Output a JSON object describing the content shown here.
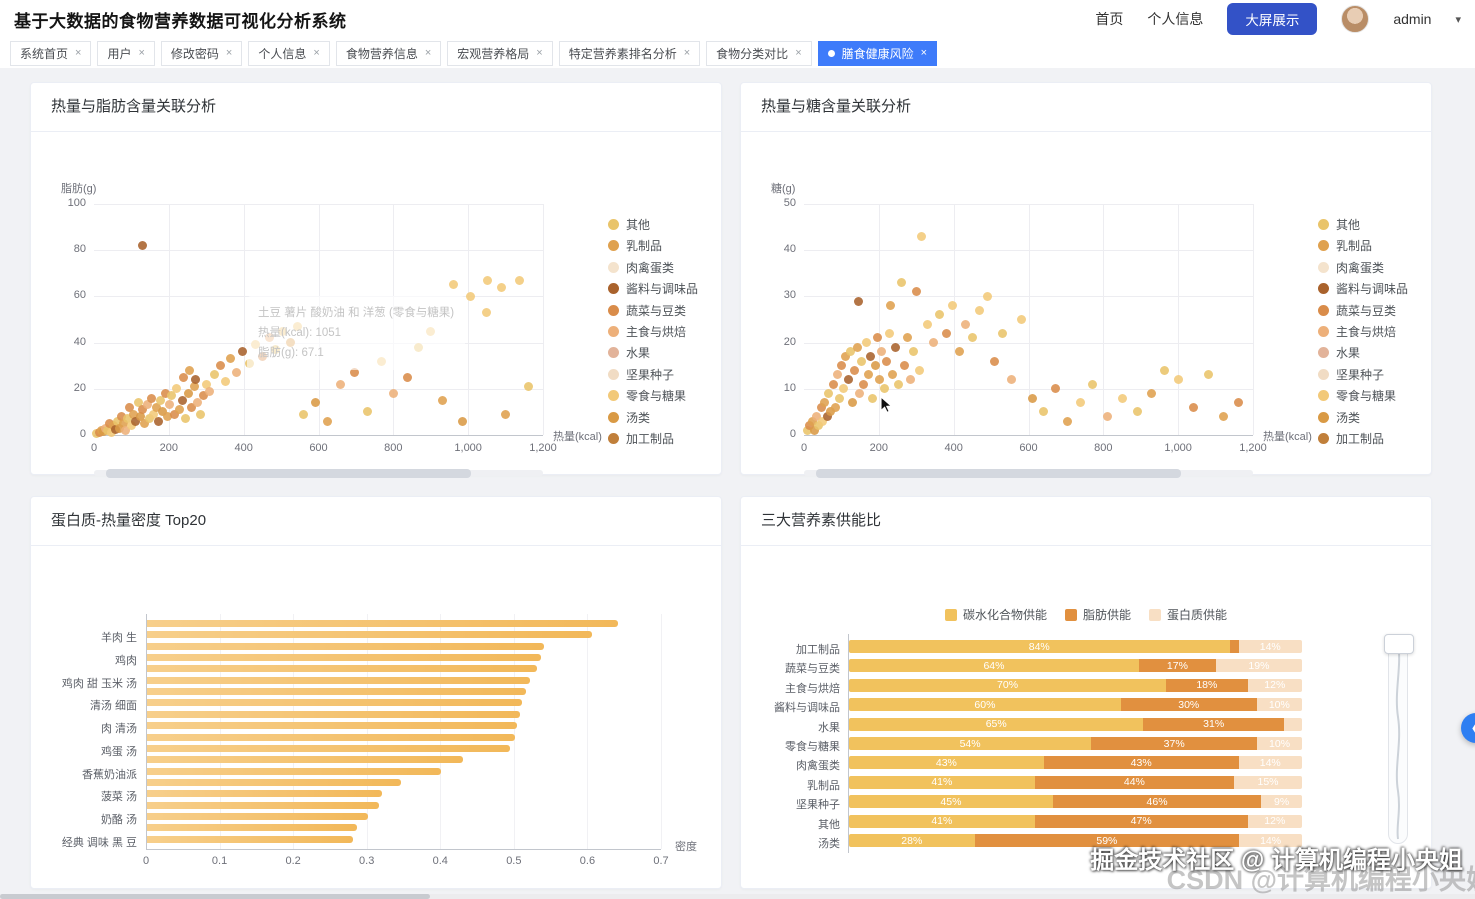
{
  "header": {
    "title": "基于大数据的食物营养数据可视化分析系统",
    "nav_home": "首页",
    "nav_profile": "个人信息",
    "screen_button": "大屏展示",
    "user": "admin"
  },
  "tabs": [
    {
      "label": "系统首页",
      "active": false
    },
    {
      "label": "用户",
      "active": false
    },
    {
      "label": "修改密码",
      "active": false
    },
    {
      "label": "个人信息",
      "active": false
    },
    {
      "label": "食物营养信息",
      "active": false
    },
    {
      "label": "宏观营养格局",
      "active": false
    },
    {
      "label": "特定营养素排名分析",
      "active": false
    },
    {
      "label": "食物分类对比",
      "active": false
    },
    {
      "label": "膳食健康风险",
      "active": true
    }
  ],
  "cards": [
    {
      "title": "热量与脂肪含量关联分析"
    },
    {
      "title": "热量与糖含量关联分析"
    },
    {
      "title": "蛋白质-热量密度 Top20"
    },
    {
      "title": "三大营养素供能比"
    }
  ],
  "watermark": {
    "front": "掘金技术社区 @ 计算机编程小央姐",
    "back": "CSDN @计算机编程小央姐"
  },
  "colors": {
    "active_tab": "#3e7bfa",
    "screen_button": "#3352c7",
    "fab": "#2e7ff2",
    "bar_light": "#f7cf8b",
    "bar": "#f2b859"
  },
  "chart_data": [
    {
      "type": "scatter",
      "title": "热量与脂肪含量关联分析",
      "xlabel": "热量(kcal)",
      "ylabel": "脂肪(g)",
      "xlim": [
        0,
        1200
      ],
      "ylim": [
        0,
        100
      ],
      "xticks": [
        "0",
        "200",
        "400",
        "600",
        "800",
        "1,000",
        "1,200"
      ],
      "yticks": [
        "0",
        "20",
        "40",
        "60",
        "80",
        "100"
      ],
      "legend": [
        "其他",
        "乳制品",
        "肉禽蛋类",
        "酱料与调味品",
        "蔬菜与豆类",
        "主食与烘焙",
        "水果",
        "坚果种子",
        "零食与糖果",
        "汤类",
        "加工制品"
      ],
      "palette": [
        "#e9c46a",
        "#dfa14f",
        "#f4e3cd",
        "#a9622c",
        "#d98c4a",
        "#edb07a",
        "#e2b39a",
        "#f1dcc4",
        "#f2c979",
        "#d99a45",
        "#c07f3a"
      ],
      "tooltip": {
        "lines": [
          "土豆 薯片 酸奶油 和 洋葱 (零食与糖果)",
          "热量(kcal): 1051",
          "脂肪(g): 67.1"
        ]
      },
      "points": [
        [
          8,
          0.5,
          0
        ],
        [
          14,
          1,
          4
        ],
        [
          20,
          2,
          1
        ],
        [
          26,
          1.5,
          9
        ],
        [
          30,
          3,
          5
        ],
        [
          36,
          2,
          0
        ],
        [
          42,
          5,
          4
        ],
        [
          46,
          1,
          8
        ],
        [
          52,
          4,
          1
        ],
        [
          58,
          2.5,
          3
        ],
        [
          62,
          6,
          0
        ],
        [
          68,
          3,
          9
        ],
        [
          74,
          8,
          4
        ],
        [
          78,
          5,
          1
        ],
        [
          84,
          2,
          5
        ],
        [
          90,
          7,
          0
        ],
        [
          96,
          12,
          4
        ],
        [
          100,
          4,
          8
        ],
        [
          106,
          9,
          1
        ],
        [
          112,
          6,
          3
        ],
        [
          118,
          14,
          0
        ],
        [
          124,
          8,
          9
        ],
        [
          130,
          11,
          4
        ],
        [
          136,
          5,
          1
        ],
        [
          142,
          13,
          5
        ],
        [
          148,
          7,
          0
        ],
        [
          154,
          16,
          4
        ],
        [
          160,
          9,
          8
        ],
        [
          166,
          12,
          1
        ],
        [
          172,
          6,
          3
        ],
        [
          178,
          15,
          0
        ],
        [
          184,
          10,
          9
        ],
        [
          190,
          18,
          4
        ],
        [
          196,
          8,
          1
        ],
        [
          202,
          13,
          5
        ],
        [
          208,
          17,
          0
        ],
        [
          214,
          9,
          4
        ],
        [
          220,
          20,
          8
        ],
        [
          228,
          11,
          1
        ],
        [
          236,
          15,
          3
        ],
        [
          244,
          7,
          0
        ],
        [
          252,
          18,
          9
        ],
        [
          260,
          12,
          4
        ],
        [
          268,
          21,
          1
        ],
        [
          276,
          14,
          5
        ],
        [
          284,
          9,
          0
        ],
        [
          292,
          17,
          4
        ],
        [
          300,
          22,
          8
        ],
        [
          240,
          25,
          4
        ],
        [
          255,
          28,
          1
        ],
        [
          270,
          24,
          3
        ],
        [
          310,
          19,
          5
        ],
        [
          322,
          26,
          0
        ],
        [
          338,
          30,
          4
        ],
        [
          352,
          23,
          8
        ],
        [
          366,
          33,
          1
        ],
        [
          380,
          27,
          5
        ],
        [
          398,
          36,
          3
        ],
        [
          415,
          31,
          0
        ],
        [
          432,
          39,
          8
        ],
        [
          450,
          34,
          4
        ],
        [
          468,
          42,
          5
        ],
        [
          486,
          37,
          0
        ],
        [
          505,
          45,
          8
        ],
        [
          524,
          40,
          1
        ],
        [
          545,
          47,
          8
        ],
        [
          130,
          82,
          3
        ],
        [
          560,
          9,
          0
        ],
        [
          592,
          14,
          9
        ],
        [
          625,
          6,
          1
        ],
        [
          660,
          22,
          5
        ],
        [
          695,
          27,
          4
        ],
        [
          730,
          10,
          0
        ],
        [
          768,
          32,
          8
        ],
        [
          800,
          18,
          5
        ],
        [
          838,
          25,
          4
        ],
        [
          868,
          38,
          0
        ],
        [
          900,
          45,
          8
        ],
        [
          932,
          15,
          1
        ],
        [
          960,
          65,
          8
        ],
        [
          1005,
          60,
          8
        ],
        [
          1050,
          53,
          8
        ],
        [
          1090,
          64,
          8
        ],
        [
          1138,
          67,
          8
        ],
        [
          1160,
          21,
          0
        ],
        [
          985,
          6,
          9
        ],
        [
          1100,
          9,
          1
        ],
        [
          1051,
          67,
          8
        ]
      ]
    },
    {
      "type": "scatter",
      "title": "热量与糖含量关联分析",
      "xlabel": "热量(kcal)",
      "ylabel": "糖(g)",
      "xlim": [
        0,
        1200
      ],
      "ylim": [
        0,
        50
      ],
      "xticks": [
        "0",
        "200",
        "400",
        "600",
        "800",
        "1,000",
        "1,200"
      ],
      "yticks": [
        "0",
        "10",
        "20",
        "30",
        "40",
        "50"
      ],
      "legend": [
        "其他",
        "乳制品",
        "肉禽蛋类",
        "酱料与调味品",
        "蔬菜与豆类",
        "主食与烘焙",
        "水果",
        "坚果种子",
        "零食与糖果",
        "汤类",
        "加工制品"
      ],
      "palette": [
        "#e9c46a",
        "#dfa14f",
        "#f4e3cd",
        "#a9622c",
        "#d98c4a",
        "#edb07a",
        "#e2b39a",
        "#f1dcc4",
        "#f2c979",
        "#d99a45",
        "#c07f3a"
      ],
      "points": [
        [
          10,
          1,
          0
        ],
        [
          16,
          2,
          4
        ],
        [
          22,
          3,
          1
        ],
        [
          28,
          1,
          9
        ],
        [
          34,
          4,
          5
        ],
        [
          40,
          2,
          0
        ],
        [
          46,
          6,
          4
        ],
        [
          50,
          3,
          8
        ],
        [
          56,
          7,
          1
        ],
        [
          62,
          4,
          3
        ],
        [
          66,
          9,
          0
        ],
        [
          72,
          5,
          9
        ],
        [
          78,
          11,
          4
        ],
        [
          84,
          6,
          1
        ],
        [
          90,
          13,
          5
        ],
        [
          96,
          8,
          0
        ],
        [
          100,
          15,
          4
        ],
        [
          106,
          10,
          8
        ],
        [
          112,
          17,
          1
        ],
        [
          118,
          12,
          3
        ],
        [
          124,
          18,
          0
        ],
        [
          130,
          7,
          9
        ],
        [
          136,
          14,
          4
        ],
        [
          142,
          19,
          1
        ],
        [
          148,
          9,
          5
        ],
        [
          154,
          16,
          0
        ],
        [
          160,
          11,
          4
        ],
        [
          166,
          20,
          8
        ],
        [
          172,
          13,
          1
        ],
        [
          178,
          17,
          3
        ],
        [
          184,
          8,
          0
        ],
        [
          190,
          15,
          9
        ],
        [
          196,
          21,
          4
        ],
        [
          202,
          12,
          1
        ],
        [
          208,
          18,
          5
        ],
        [
          214,
          10,
          0
        ],
        [
          220,
          16,
          4
        ],
        [
          228,
          22,
          8
        ],
        [
          236,
          13,
          1
        ],
        [
          244,
          19,
          3
        ],
        [
          252,
          11,
          0
        ],
        [
          260,
          33,
          0
        ],
        [
          268,
          15,
          4
        ],
        [
          276,
          21,
          1
        ],
        [
          284,
          12,
          5
        ],
        [
          292,
          18,
          0
        ],
        [
          300,
          31,
          4
        ],
        [
          308,
          14,
          8
        ],
        [
          145,
          29,
          3
        ],
        [
          230,
          28,
          1
        ],
        [
          313,
          43,
          8
        ],
        [
          330,
          24,
          8
        ],
        [
          345,
          20,
          5
        ],
        [
          362,
          26,
          0
        ],
        [
          380,
          22,
          4
        ],
        [
          398,
          28,
          8
        ],
        [
          415,
          18,
          1
        ],
        [
          432,
          24,
          5
        ],
        [
          450,
          21,
          0
        ],
        [
          470,
          27,
          8
        ],
        [
          490,
          30,
          8
        ],
        [
          510,
          16,
          4
        ],
        [
          530,
          22,
          0
        ],
        [
          555,
          12,
          5
        ],
        [
          580,
          25,
          8
        ],
        [
          610,
          8,
          9
        ],
        [
          640,
          5,
          0
        ],
        [
          672,
          10,
          4
        ],
        [
          705,
          3,
          1
        ],
        [
          740,
          7,
          8
        ],
        [
          771,
          11,
          0
        ],
        [
          810,
          4,
          5
        ],
        [
          850,
          8,
          8
        ],
        [
          890,
          5,
          0
        ],
        [
          930,
          9,
          1
        ],
        [
          963,
          14,
          0
        ],
        [
          1000,
          12,
          8
        ],
        [
          1040,
          6,
          4
        ],
        [
          1080,
          13,
          0
        ],
        [
          1120,
          4,
          1
        ],
        [
          1160,
          7,
          4
        ]
      ]
    },
    {
      "type": "bar",
      "title": "蛋白质-热量密度 Top20",
      "xlabel": "密度",
      "xlim": [
        0,
        0.7
      ],
      "xticks": [
        "0",
        "0.1",
        "0.2",
        "0.3",
        "0.4",
        "0.5",
        "0.6",
        "0.7"
      ],
      "bars": [
        {
          "label": "",
          "value": 0.64
        },
        {
          "label": "羊肉 生",
          "value": 0.605
        },
        {
          "label": "",
          "value": 0.54
        },
        {
          "label": "鸡肉",
          "value": 0.535
        },
        {
          "label": "",
          "value": 0.53
        },
        {
          "label": "鸡肉 甜 玉米 汤",
          "value": 0.52
        },
        {
          "label": "",
          "value": 0.515
        },
        {
          "label": "清汤 细面",
          "value": 0.51
        },
        {
          "label": "",
          "value": 0.507
        },
        {
          "label": "肉 清汤",
          "value": 0.503
        },
        {
          "label": "",
          "value": 0.5
        },
        {
          "label": "鸡蛋 汤",
          "value": 0.494
        },
        {
          "label": "",
          "value": 0.43
        },
        {
          "label": "香蕉奶油派",
          "value": 0.4
        },
        {
          "label": "",
          "value": 0.345
        },
        {
          "label": "菠菜 汤",
          "value": 0.32
        },
        {
          "label": "",
          "value": 0.315
        },
        {
          "label": "奶酪 汤",
          "value": 0.3
        },
        {
          "label": "",
          "value": 0.285
        },
        {
          "label": "经典 调味 黑 豆",
          "value": 0.28
        }
      ]
    },
    {
      "type": "bar-stacked",
      "title": "三大营养素供能比",
      "legend": [
        {
          "label": "碳水化合物供能",
          "color": "#f1c25d"
        },
        {
          "label": "脂肪供能",
          "color": "#e1903f"
        },
        {
          "label": "蛋白质供能",
          "color": "#f8dfc4"
        }
      ],
      "rows": [
        {
          "label": "加工制品",
          "values": [
            84,
            2,
            14
          ],
          "labels": [
            "84%",
            "",
            "14%"
          ]
        },
        {
          "label": "蔬菜与豆类",
          "values": [
            64,
            17,
            19
          ],
          "labels": [
            "64%",
            "17%",
            "19%"
          ]
        },
        {
          "label": "主食与烘焙",
          "values": [
            70,
            18,
            12
          ],
          "labels": [
            "70%",
            "18%",
            "12%"
          ]
        },
        {
          "label": "酱料与调味品",
          "values": [
            60,
            30,
            10
          ],
          "labels": [
            "60%",
            "30%",
            "10%"
          ]
        },
        {
          "label": "水果",
          "values": [
            65,
            31,
            4
          ],
          "labels": [
            "65%",
            "31%",
            ""
          ]
        },
        {
          "label": "零食与糖果",
          "values": [
            54,
            37,
            10
          ],
          "labels": [
            "54%",
            "37%",
            "10%"
          ]
        },
        {
          "label": "肉禽蛋类",
          "values": [
            43,
            43,
            14
          ],
          "labels": [
            "43%",
            "43%",
            "14%"
          ]
        },
        {
          "label": "乳制品",
          "values": [
            41,
            44,
            15
          ],
          "labels": [
            "41%",
            "44%",
            "15%"
          ]
        },
        {
          "label": "坚果种子",
          "values": [
            45,
            46,
            9
          ],
          "labels": [
            "45%",
            "46%",
            "9%"
          ]
        },
        {
          "label": "其他",
          "values": [
            41,
            47,
            12
          ],
          "labels": [
            "41%",
            "47%",
            "12%"
          ]
        },
        {
          "label": "汤类",
          "values": [
            28,
            59,
            14
          ],
          "labels": [
            "28%",
            "59%",
            "14%"
          ]
        }
      ]
    }
  ]
}
